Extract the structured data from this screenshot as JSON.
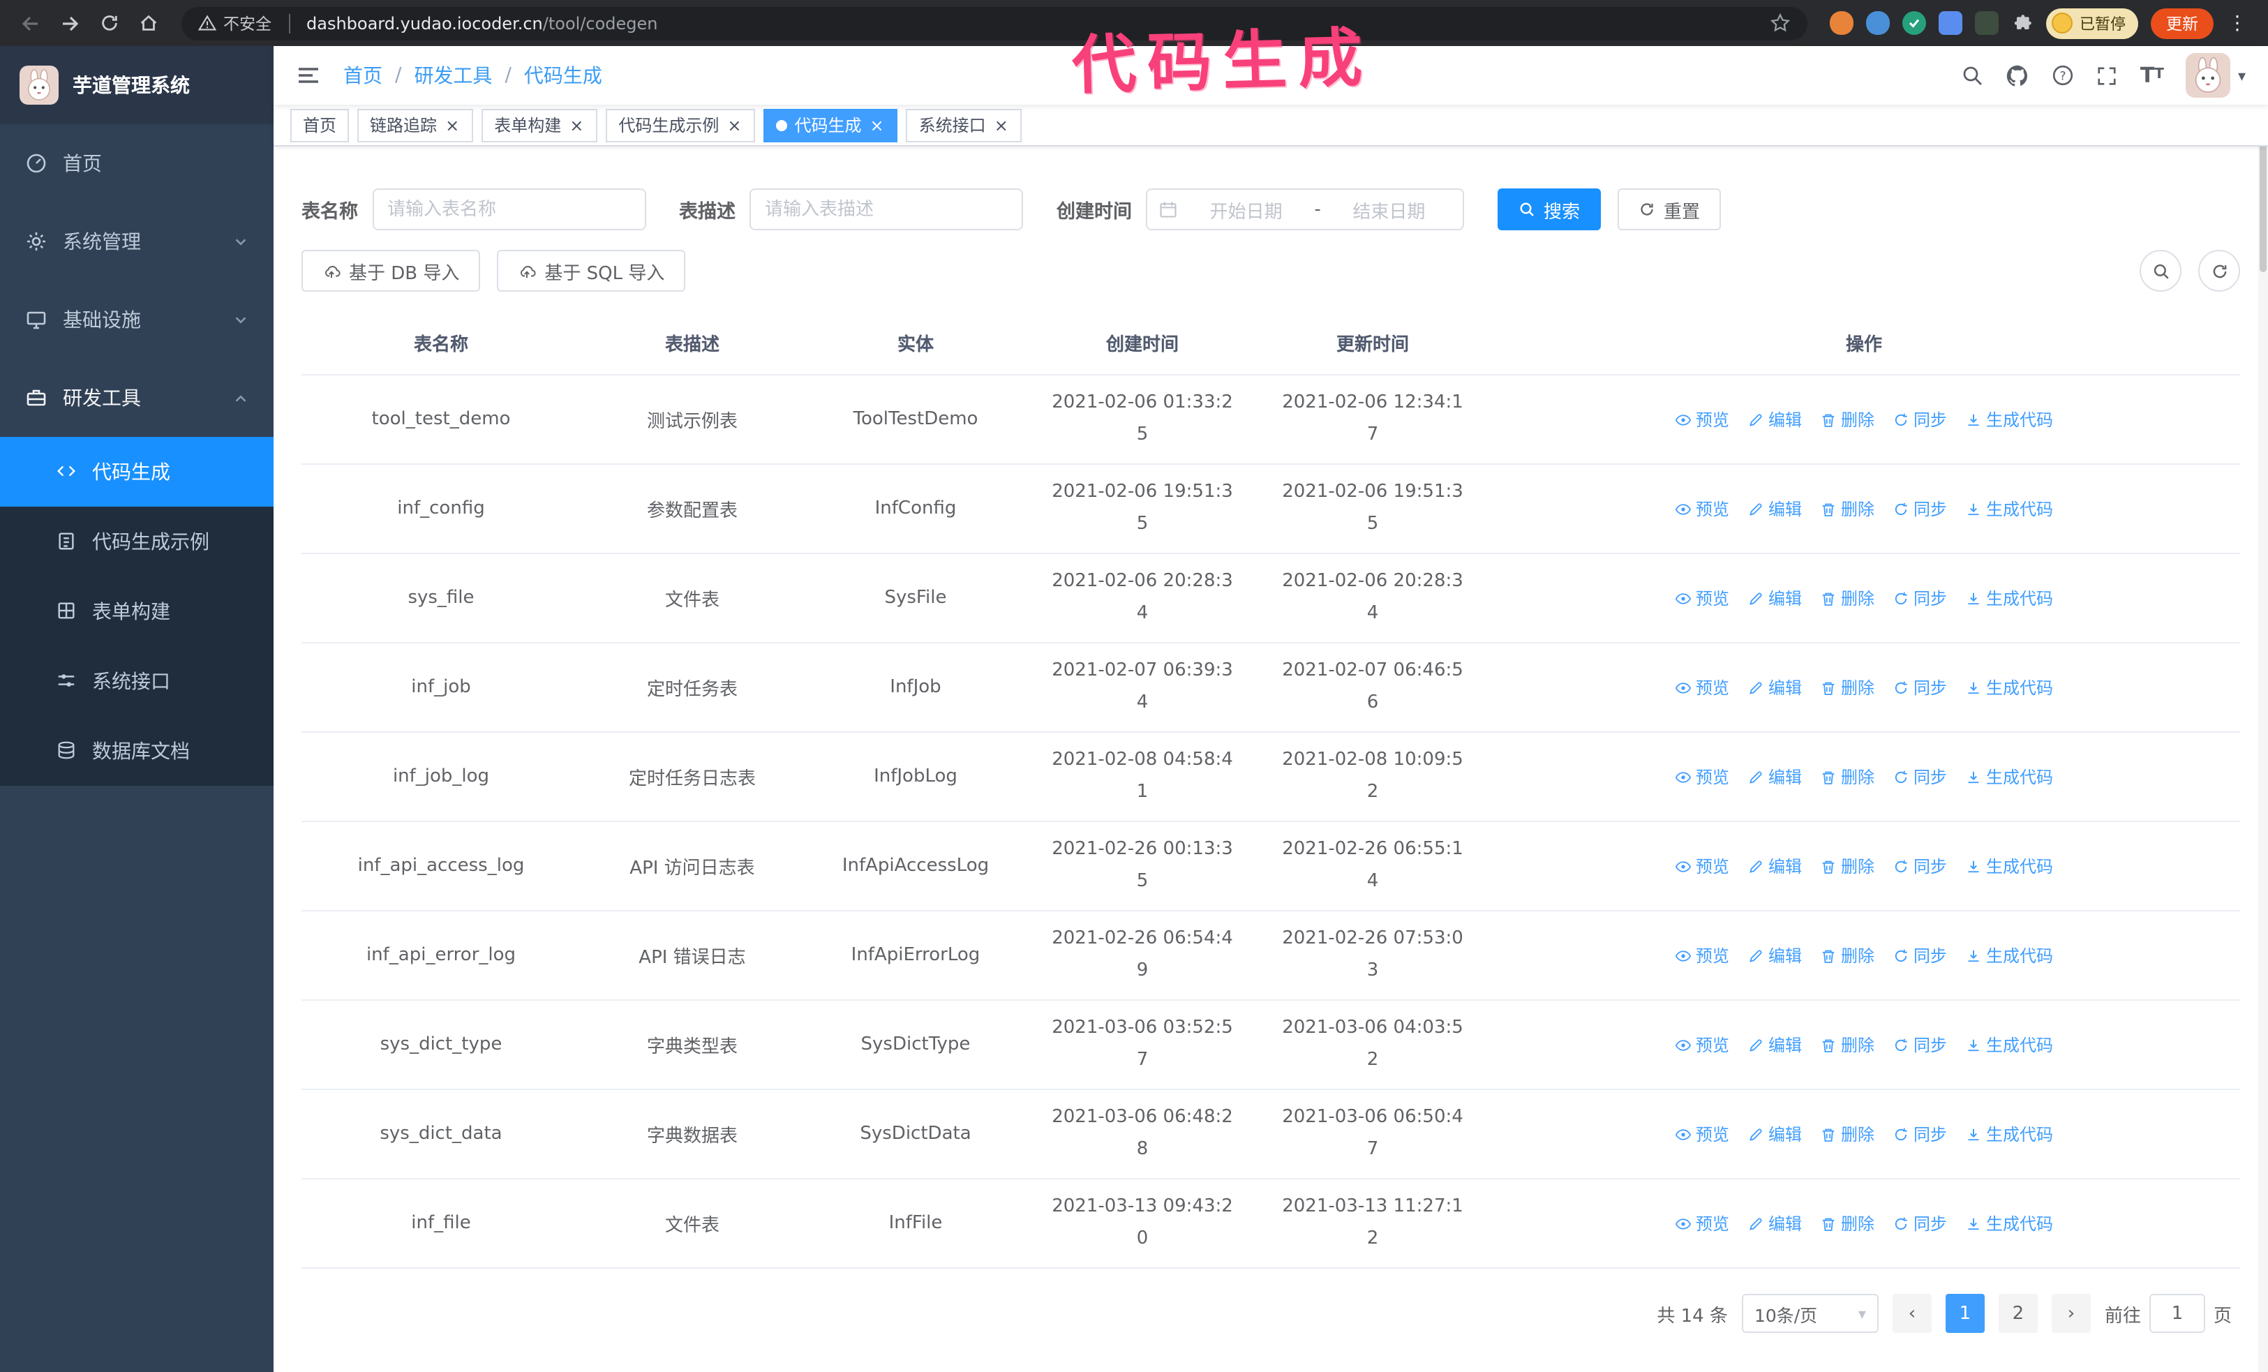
{
  "icons": {
    "close": "×",
    "kebab": "⋮",
    "caret": "▾",
    "prev": "‹",
    "next": "›",
    "font_size": "T"
  },
  "browser": {
    "security_label": "不安全",
    "url_host": "dashboard.yudao.iocoder.cn",
    "url_path": "/tool/codegen",
    "paused_badge": "已暂停",
    "update_label": "更新"
  },
  "annotation": {
    "text": "代码生成"
  },
  "sidebar": {
    "logo_title": "芋道管理系统",
    "items": [
      {
        "label": "首页"
      },
      {
        "label": "系统管理"
      },
      {
        "label": "基础设施"
      },
      {
        "label": "研发工具"
      }
    ],
    "subitems": [
      {
        "label": "代码生成",
        "active": true
      },
      {
        "label": "代码生成示例"
      },
      {
        "label": "表单构建"
      },
      {
        "label": "系统接口"
      },
      {
        "label": "数据库文档"
      }
    ]
  },
  "breadcrumb": {
    "separator": "/",
    "items": [
      "首页",
      "研发工具",
      "代码生成"
    ]
  },
  "tabs": [
    {
      "label": "首页",
      "closable": false,
      "active": false
    },
    {
      "label": "链路追踪",
      "closable": true,
      "active": false
    },
    {
      "label": "表单构建",
      "closable": true,
      "active": false
    },
    {
      "label": "代码生成示例",
      "closable": true,
      "active": false
    },
    {
      "label": "代码生成",
      "closable": true,
      "active": true
    },
    {
      "label": "系统接口",
      "closable": true,
      "active": false
    }
  ],
  "filters": {
    "table_name_label": "表名称",
    "table_name_placeholder": "请输入表名称",
    "table_desc_label": "表描述",
    "table_desc_placeholder": "请输入表描述",
    "create_time_label": "创建时间",
    "date_start_placeholder": "开始日期",
    "date_separator": "-",
    "date_end_placeholder": "结束日期",
    "search_label": "搜索",
    "reset_label": "重置"
  },
  "toolbar": {
    "import_db_label": "基于 DB 导入",
    "import_sql_label": "基于 SQL 导入"
  },
  "table": {
    "columns": [
      "表名称",
      "表描述",
      "实体",
      "创建时间",
      "更新时间",
      "操作"
    ],
    "actions": [
      "预览",
      "编辑",
      "删除",
      "同步",
      "生成代码"
    ],
    "rows": [
      {
        "name": "tool_test_demo",
        "desc": "测试示例表",
        "entity": "ToolTestDemo",
        "created": "2021-02-06 01:33:25",
        "updated": "2021-02-06 12:34:17"
      },
      {
        "name": "inf_config",
        "desc": "参数配置表",
        "entity": "InfConfig",
        "created": "2021-02-06 19:51:35",
        "updated": "2021-02-06 19:51:35"
      },
      {
        "name": "sys_file",
        "desc": "文件表",
        "entity": "SysFile",
        "created": "2021-02-06 20:28:34",
        "updated": "2021-02-06 20:28:34"
      },
      {
        "name": "inf_job",
        "desc": "定时任务表",
        "entity": "InfJob",
        "created": "2021-02-07 06:39:34",
        "updated": "2021-02-07 06:46:56"
      },
      {
        "name": "inf_job_log",
        "desc": "定时任务日志表",
        "entity": "InfJobLog",
        "created": "2021-02-08 04:58:41",
        "updated": "2021-02-08 10:09:52"
      },
      {
        "name": "inf_api_access_log",
        "desc": "API 访问日志表",
        "entity": "InfApiAccessLog",
        "created": "2021-02-26 00:13:35",
        "updated": "2021-02-26 06:55:14"
      },
      {
        "name": "inf_api_error_log",
        "desc": "API 错误日志",
        "entity": "InfApiErrorLog",
        "created": "2021-02-26 06:54:49",
        "updated": "2021-02-26 07:53:03"
      },
      {
        "name": "sys_dict_type",
        "desc": "字典类型表",
        "entity": "SysDictType",
        "created": "2021-03-06 03:52:57",
        "updated": "2021-03-06 04:03:52"
      },
      {
        "name": "sys_dict_data",
        "desc": "字典数据表",
        "entity": "SysDictData",
        "created": "2021-03-06 06:48:28",
        "updated": "2021-03-06 06:50:47"
      },
      {
        "name": "inf_file",
        "desc": "文件表",
        "entity": "InfFile",
        "created": "2021-03-13 09:43:20",
        "updated": "2021-03-13 11:27:12"
      }
    ]
  },
  "pagination": {
    "total": "共 14 条",
    "page_size": "10条/页",
    "pages": [
      "1",
      "2"
    ],
    "goto_label": "前往",
    "goto_value": "1",
    "goto_suffix": "页"
  }
}
